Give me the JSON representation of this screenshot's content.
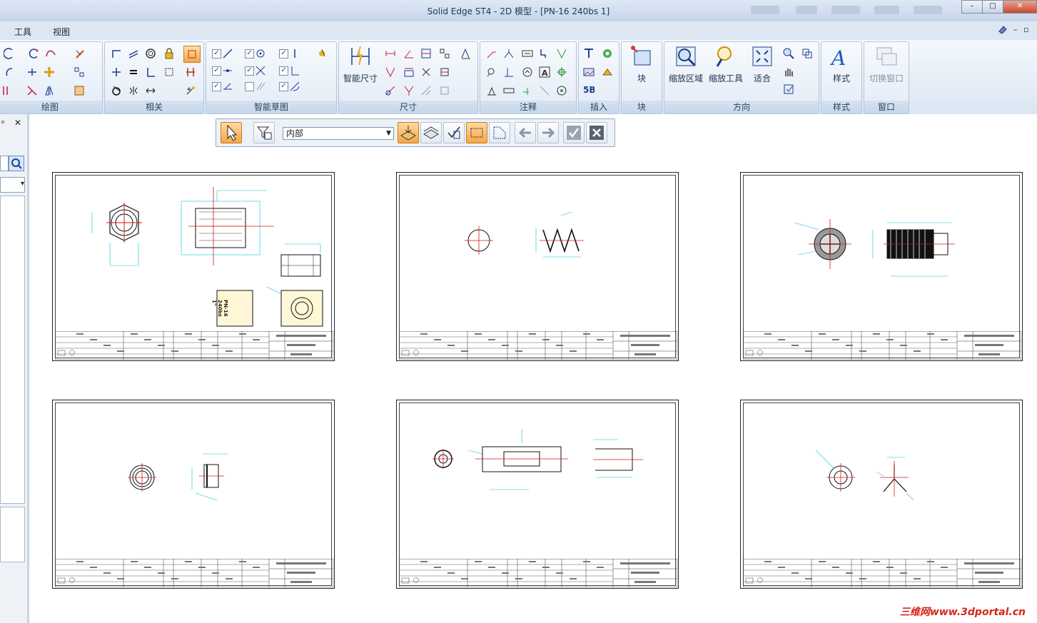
{
  "window": {
    "title": "Solid Edge ST4 - 2D 模型 - [PN-16 240bs 1]",
    "min": "–",
    "max": "□",
    "close": "✕"
  },
  "menu": {
    "items": [
      "工具",
      "视图"
    ]
  },
  "ribbon": {
    "groups": {
      "draw": "绘图",
      "relate": "相关",
      "smart_sketch": "智能草图",
      "dimension": "尺寸",
      "annotation": "注释",
      "insert": "插入",
      "block": "块",
      "orient": "方向",
      "style": "样式",
      "window": "窗口"
    },
    "big_buttons": {
      "smart_dim": "智能尺寸",
      "block": "块",
      "zoom_area": "缩放区域",
      "zoom_tool": "缩放工具",
      "fit": "适合",
      "style": "样式",
      "switch_window": "切换窗口"
    }
  },
  "command_bar": {
    "select_value": "内部"
  },
  "left_pane": {
    "pin": "ᵖ",
    "close": "✕"
  },
  "sheets": [
    {
      "label": "PN-16\n240bs\n1\""
    },
    {},
    {},
    {},
    {},
    {}
  ],
  "watermark": "三维网www.3dportal.cn",
  "colors": {
    "dim": "#00c8d8",
    "center": "#d61a1a",
    "accent": "#f7a545"
  }
}
